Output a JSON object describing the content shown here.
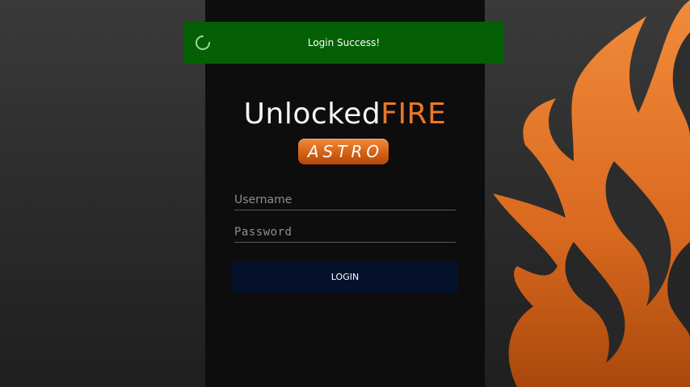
{
  "toast": {
    "message": "Login Success!",
    "icon": "spinner-icon",
    "color": "#056005"
  },
  "logo": {
    "word_part1": "Unlocked",
    "word_part2": "FIRE",
    "badge": "ASTRO",
    "accent_color": "#e9782a"
  },
  "form": {
    "username_placeholder": "Username",
    "username_value": "",
    "password_placeholder": "Password",
    "password_value": "",
    "login_label": "LOGIN",
    "login_color": "#05112b"
  },
  "background": {
    "decoration": "flame-graphic",
    "flame_color": "#e9782a"
  }
}
